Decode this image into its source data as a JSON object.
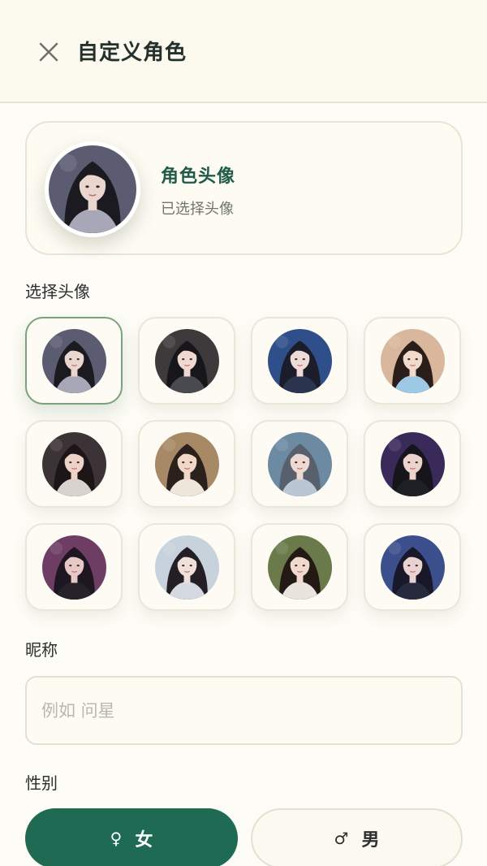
{
  "header": {
    "title": "自定义角色",
    "close_icon": "close-icon"
  },
  "preview": {
    "title": "角色头像",
    "subtitle": "已选择头像"
  },
  "sections": {
    "avatar": "选择头像",
    "nickname": "昵称",
    "gender": "性别"
  },
  "avatars": [
    {
      "id": 1,
      "bg": "#5b5c72",
      "hair": "#1b1a20",
      "skin": "#e9d6cf",
      "cloth": "#a7a7b8",
      "selected": true
    },
    {
      "id": 2,
      "bg": "#3e3a3b",
      "hair": "#17161a",
      "skin": "#eed8cf",
      "cloth": "#4a4b50",
      "selected": false
    },
    {
      "id": 3,
      "bg": "#2f4f8a",
      "hair": "#1c1d2a",
      "skin": "#eedad6",
      "cloth": "#2c3550",
      "selected": false
    },
    {
      "id": 4,
      "bg": "#d9b79d",
      "hair": "#2a1e1b",
      "skin": "#f1d9cb",
      "cloth": "#9ec9e6",
      "selected": false
    },
    {
      "id": 5,
      "bg": "#3b3335",
      "hair": "#1c1619",
      "skin": "#ecd2c7",
      "cloth": "#d8d3cf",
      "selected": false
    },
    {
      "id": 6,
      "bg": "#a78965",
      "hair": "#2a201c",
      "skin": "#f0d7c6",
      "cloth": "#efe6da",
      "selected": false
    },
    {
      "id": 7,
      "bg": "#6c8aa1",
      "hair": "#57606c",
      "skin": "#edd9d2",
      "cloth": "#b9c6d4",
      "selected": false
    },
    {
      "id": 8,
      "bg": "#3a2a5a",
      "hair": "#17151c",
      "skin": "#ecd4cd",
      "cloth": "#1f2026",
      "selected": false
    },
    {
      "id": 9,
      "bg": "#6d3d63",
      "hair": "#1e1620",
      "skin": "#e6c9c6",
      "cloth": "#25222a",
      "selected": false
    },
    {
      "id": 10,
      "bg": "#c8d2dc",
      "hair": "#231f24",
      "skin": "#f1e0da",
      "cloth": "#d5dae2",
      "selected": false
    },
    {
      "id": 11,
      "bg": "#6a7a4a",
      "hair": "#231a16",
      "skin": "#f0d9cd",
      "cloth": "#e9e4de",
      "selected": false
    },
    {
      "id": 12,
      "bg": "#3b4f8c",
      "hair": "#19182a",
      "skin": "#e8d2d2",
      "cloth": "#262a3c",
      "selected": false
    }
  ],
  "nickname": {
    "value": "",
    "placeholder": "例如 问星"
  },
  "gender": {
    "female": {
      "symbol": "♀",
      "label": "女",
      "selected": true
    },
    "male": {
      "symbol": "♂",
      "label": "男",
      "selected": false
    }
  },
  "colors": {
    "accent": "#1f6a53",
    "background": "#fdfcf6",
    "selected_border": "#7aa27d"
  }
}
